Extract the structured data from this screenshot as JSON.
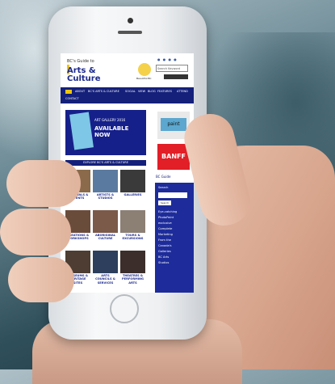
{
  "site": {
    "logo_top": "BC's Guide to",
    "logo_main": "Arts & Culture",
    "search_placeholder": "Search Keyword",
    "badge_text": "Beautiful BC"
  },
  "nav": {
    "items": [
      "ABOUT",
      "BC'S ARTS & CULTURE",
      "SOCIAL",
      "VIEW",
      "BLOG",
      "FEATURES",
      "ATTEND",
      "CONTACT"
    ]
  },
  "hero": {
    "line1": "ART GALLERY 2016",
    "line2": "AVAILABLE NOW",
    "line3": ""
  },
  "grid": {
    "heading": "EXPLORE BC'S ARTS & CULTURE",
    "items": [
      {
        "label": "FESTIVALS & EVENTS",
        "color": "#8a6a4a"
      },
      {
        "label": "ARTISTS & STUDIOS",
        "color": "#5b7aa0"
      },
      {
        "label": "GALLERIES",
        "color": "#3a3a3a"
      },
      {
        "label": "CREATIONS & WORKSHOPS",
        "color": "#6a4c3b"
      },
      {
        "label": "ABORIGINAL CULTURE",
        "color": "#7b5a4a"
      },
      {
        "label": "TOURS & EXCURSIONS",
        "color": "#8c7f74"
      },
      {
        "label": "MUSEUMS & HERITAGE SITES",
        "color": "#4d3d32"
      },
      {
        "label": "ARTS COUNCILS & SERVICES",
        "color": "#2d3f5c"
      },
      {
        "label": "THEATRES & PERFORMING ARTS",
        "color": "#3b2e2b"
      }
    ]
  },
  "sidebar": {
    "ad1": "paint",
    "ad2": "BANFF",
    "label": "BC Guide",
    "search_label": "Search",
    "search_btn": "Search",
    "text_lines": [
      "Eye-catching",
      "PhotoPaint",
      "exclusive",
      "Complete",
      "Marketing",
      "From the",
      "Canada's",
      "Galleries",
      "BC Arts",
      "Studios"
    ]
  },
  "colors": {
    "brand_blue": "#14207a",
    "accent_yellow": "#f2c500",
    "ad_red": "#e21e26"
  }
}
